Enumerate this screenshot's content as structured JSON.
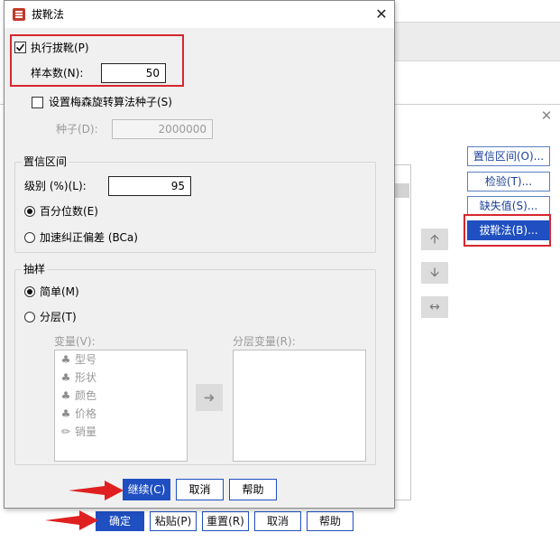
{
  "dialog": {
    "title": "拔靴法",
    "close_glyph": "✕",
    "perform_bootstrap": {
      "label": "执行拔靴(P)",
      "checked": true
    },
    "sample_count": {
      "label": "样本数(N):",
      "value": "50"
    },
    "mersenne": {
      "label": "设置梅森旋转算法种子(S)",
      "checked": false
    },
    "seed": {
      "label": "种子(D):",
      "value": "2000000"
    },
    "confidence": {
      "title": "置信区间",
      "level_label": "级别 (%)(L):",
      "level_value": "95",
      "options": [
        "百分位数(E)",
        "加速纠正偏差 (BCa)"
      ],
      "selected": "百分位数(E)"
    },
    "sampling": {
      "title": "抽样",
      "options": [
        "简单(M)",
        "分层(T)"
      ],
      "selected": "简单(M)",
      "variables_label": "变量(V):",
      "strata_label": "分层变量(R):",
      "variables": [
        {
          "name": "型号",
          "icon": "nominal-icon"
        },
        {
          "name": "形状",
          "icon": "nominal-icon"
        },
        {
          "name": "颜色",
          "icon": "nominal-icon"
        },
        {
          "name": "价格",
          "icon": "ordinal-icon"
        },
        {
          "name": "销量",
          "icon": "scale-icon"
        }
      ]
    },
    "buttons": {
      "continue": "继续(C)",
      "cancel": "取消",
      "help": "帮助"
    }
  },
  "background": {
    "close_glyph": "✕",
    "side_buttons": [
      "置信区间(O)...",
      "检验(T)...",
      "缺失值(S)...",
      "拔靴法(B)..."
    ],
    "footer_buttons": [
      "确定",
      "粘贴(P)",
      "重置(R)",
      "取消",
      "帮助"
    ]
  },
  "colors": {
    "accent": "#1f4fc1",
    "highlight_box": "#d7262e",
    "annotation_arrow": "#e02020"
  }
}
